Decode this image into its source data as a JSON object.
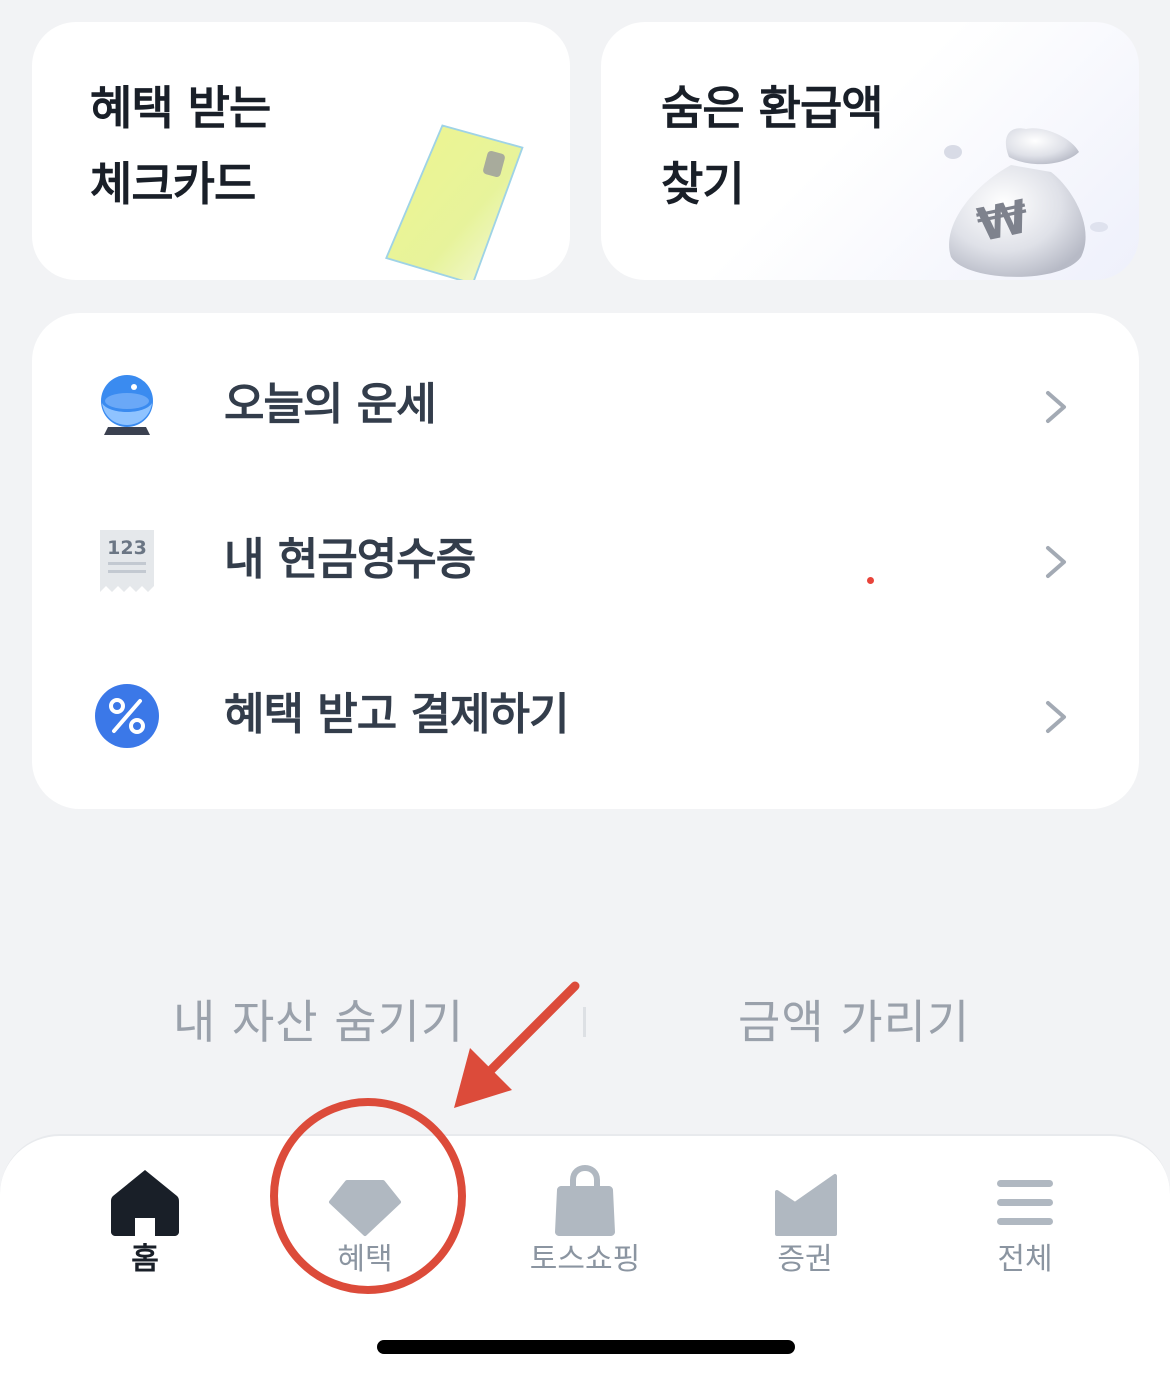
{
  "promo_cards": [
    {
      "line1": "혜택 받는",
      "line2": "체크카드"
    },
    {
      "line1": "숨은 환급액",
      "line2": "찾기"
    }
  ],
  "menu": {
    "items": [
      {
        "label": "오늘의 운세",
        "icon": "crystal-ball-icon"
      },
      {
        "label": "내 현금영수증",
        "icon": "receipt-icon",
        "icon_text": "123"
      },
      {
        "label": "혜택 받고 결제하기",
        "icon": "percent-badge-icon"
      }
    ]
  },
  "asset_controls": {
    "hide_assets": "내 자산 숨기기",
    "hide_amounts": "금액 가리기"
  },
  "tabbar": {
    "tabs": [
      {
        "label": "홈",
        "icon": "home-icon",
        "active": true
      },
      {
        "label": "혜택",
        "icon": "diamond-icon",
        "active": false
      },
      {
        "label": "토스쇼핑",
        "icon": "shopping-bag-icon",
        "active": false
      },
      {
        "label": "증권",
        "icon": "chart-icon",
        "active": false
      },
      {
        "label": "전체",
        "icon": "menu-icon",
        "active": false
      }
    ]
  },
  "colors": {
    "background": "#f2f3f5",
    "card": "#ffffff",
    "text_primary": "#191f28",
    "text_secondary": "#8b95a1",
    "accent_blue": "#3182f6",
    "annotation_red": "#dc4b3a"
  }
}
